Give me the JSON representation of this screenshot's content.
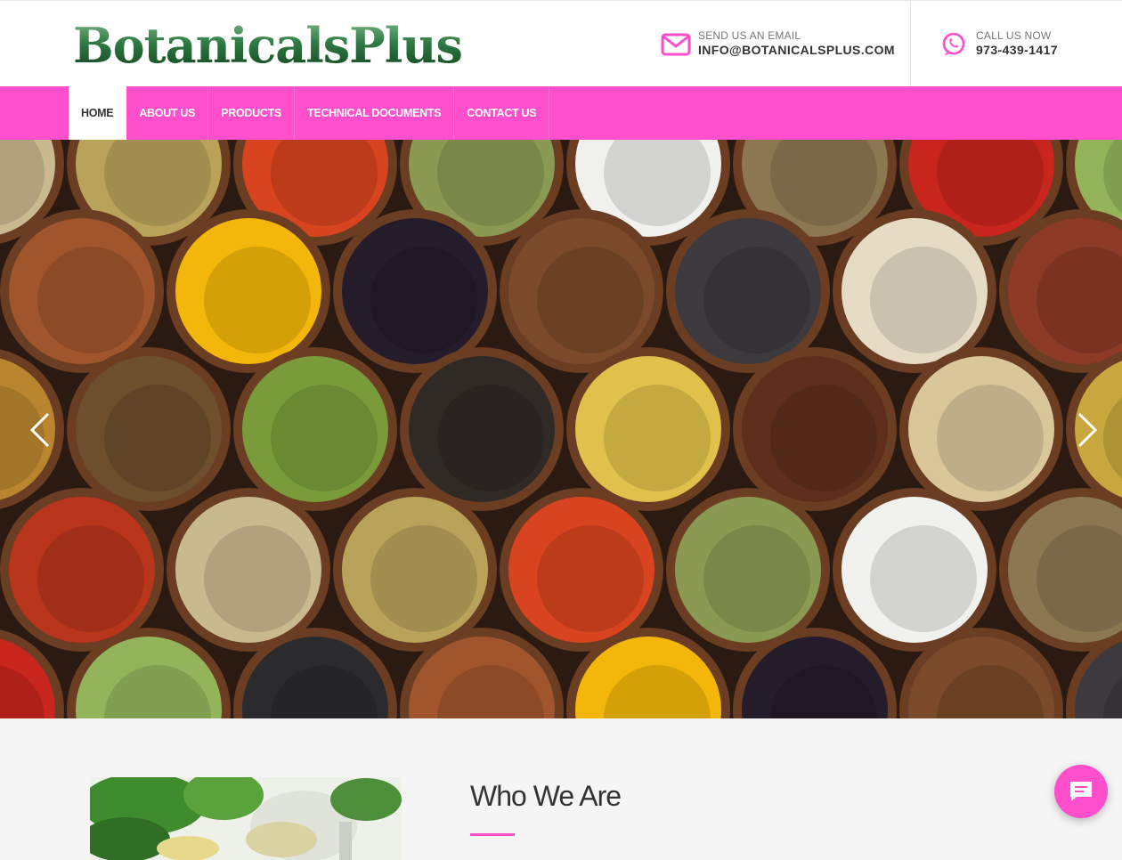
{
  "brand": {
    "logo_text": "BotanicalsPlus",
    "accent_color": "#ff4fcc",
    "logo_color": "#2f7a45"
  },
  "header": {
    "email": {
      "label": "SEND US AN EMAIL",
      "value": "INFO@BOTANICALSPLUS.COM",
      "icon": "envelope-icon"
    },
    "phone": {
      "label": "CALL US NOW",
      "value": "973-439-1417",
      "icon": "whatsapp-phone-icon"
    }
  },
  "nav": {
    "items": [
      {
        "label": "HOME",
        "active": true
      },
      {
        "label": "ABOUT US",
        "active": false
      },
      {
        "label": "PRODUCTS",
        "active": false
      },
      {
        "label": "TECHNICAL DOCUMENTS",
        "active": false
      },
      {
        "label": "CONTACT US",
        "active": false
      }
    ]
  },
  "hero": {
    "image": "spice-bowls-photo",
    "prev_icon": "chevron-left-icon",
    "next_icon": "chevron-right-icon"
  },
  "about": {
    "title": "Who We Are",
    "image": "herbs-mortar-photo"
  },
  "chat": {
    "icon": "chat-bubble-icon"
  }
}
